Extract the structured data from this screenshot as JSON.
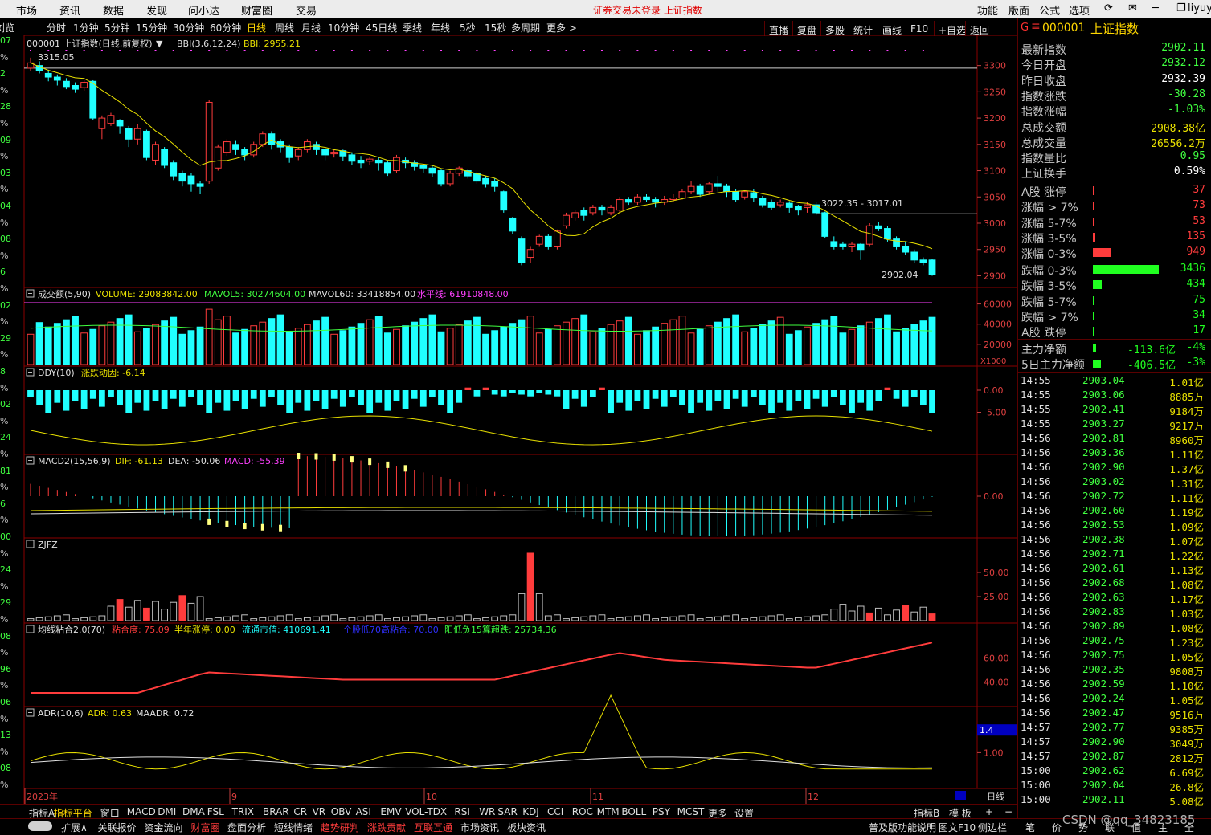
{
  "menubar": {
    "left": [
      "市场",
      "资讯",
      "数据",
      "发现",
      "问小达",
      "财富圈",
      "交易"
    ],
    "status": "证券交易未登录  上证指数",
    "right": [
      "功能",
      "版面",
      "公式",
      "选项"
    ],
    "user": "liyuyi"
  },
  "toolbar": {
    "left_clip": "浏览",
    "periods": [
      "分时",
      "1分钟",
      "5分钟",
      "15分钟",
      "30分钟",
      "60分钟",
      "日线",
      "周线",
      "月线",
      "10分钟",
      "45日线",
      "季线",
      "年线",
      "5秒",
      "15秒",
      "多周期",
      "更多 >"
    ],
    "active": "日线",
    "right": [
      "直播",
      "复盘",
      "多股",
      "统计",
      "画线",
      "F10",
      "+自选",
      "返回"
    ]
  },
  "left_strip": [
    "07",
    "%",
    "2",
    "%",
    "28",
    "%",
    "09",
    "%",
    "03",
    "%",
    "04",
    "%",
    "08",
    "%",
    "6",
    "%",
    "02",
    "%",
    "29",
    "%",
    "8",
    "%",
    "02",
    "%",
    "24",
    "%",
    "81",
    "%",
    "6",
    "%",
    "00",
    "%",
    "24",
    "%",
    "29",
    "%",
    "08",
    "%",
    "96",
    "%",
    "06",
    "%",
    "13",
    "%",
    "08",
    "%"
  ],
  "main_panel": {
    "title": "000001 上证指数(日线,前复权)",
    "bbi_label": "BBI(3,6,12,24)",
    "bbi_value": "BBI: 2955.21",
    "high_label": "3315.05",
    "mid_label": "3022.35 - 3017.01",
    "low_label": "2902.04",
    "y_ticks": [
      "3300",
      "3250",
      "3200",
      "3150",
      "3100",
      "3050",
      "3000",
      "2950",
      "2900"
    ]
  },
  "volume_panel": {
    "title": "成交额(5,90)",
    "volume": "VOLUME: 29083842.00",
    "mavol5": "MAVOL5: 30274604.00",
    "mavol60": "MAVOL60: 33418854.00",
    "level": "水平线: 61910848.00",
    "y_ticks": [
      "60000",
      "40000",
      "20000"
    ],
    "unit": "X1000"
  },
  "ddy_panel": {
    "title": "DDY(10)",
    "value": "涨跌动因: -6.14",
    "y_ticks": [
      "0.00",
      "-5.00"
    ]
  },
  "macd_panel": {
    "title": "MACD2(15,56,9)",
    "dif": "DIF: -61.13",
    "dea": "DEA: -50.06",
    "macd": "MACD: -55.39",
    "y_ticks": [
      "0.00"
    ]
  },
  "zjfz_panel": {
    "title": "ZJFZ",
    "y_ticks": [
      "50.00",
      "25.00"
    ]
  },
  "jxnh_panel": {
    "title": "均线粘合2.0(70)",
    "v1": "粘合度: 75.09",
    "v2": "半年涨停: 0.00",
    "v3": "流通市值: 410691.41",
    "v4": "个股低70高粘合: 70.00",
    "v5": "阳低负15算超跌: 25734.36",
    "y_ticks": [
      "60.00",
      "40.00"
    ]
  },
  "adr_panel": {
    "title": "ADR(10,6)",
    "adr": "ADR: 0.63",
    "maadr": "MAADR: 0.72",
    "y_ticks": [
      "1.00"
    ],
    "marker": "1.4"
  },
  "x_axis": {
    "labels": [
      "2023年",
      "9",
      "10",
      "11",
      "12"
    ],
    "right": "日线"
  },
  "indicator_tabs": [
    "指标A",
    "指标平台",
    "窗口",
    "MACD",
    "DMI",
    "DMA",
    "FSL",
    "TRIX",
    "BRAR",
    "CR",
    "VR",
    "OBV",
    "ASI",
    "EMV",
    "VOL-TDX",
    "RSI",
    "WR",
    "SAR",
    "KDJ",
    "CCI",
    "ROC",
    "MTM",
    "BOLL",
    "PSY",
    "MCST",
    "更多",
    "设置"
  ],
  "indicator_right": [
    "指标B",
    "模 板"
  ],
  "bottom_tabs": [
    "扩展∧",
    "关联报价",
    "资金流向",
    "财富圈",
    "盘面分析",
    "短线情绪",
    "趋势研判",
    "涨跌贡献",
    "互联互通",
    "市场资讯",
    "板块资讯"
  ],
  "bottom_right": [
    "普及版功能说明",
    "图文F10",
    "侧边栏"
  ],
  "bottom_far": [
    "笔",
    "价",
    "势",
    "联",
    "值",
    "主",
    "全"
  ],
  "watermark": "CSDN @qq_34823185",
  "quote": {
    "header_code": "000001",
    "header_name": "上证指数",
    "rows": [
      {
        "label": "最新指数",
        "value": "2902.11",
        "color": "#40ff40"
      },
      {
        "label": "今日开盘",
        "value": "2932.12",
        "color": "#40ff40"
      },
      {
        "label": "昨日收盘",
        "value": "2932.39",
        "color": "#ffffff"
      },
      {
        "label": "指数涨跌",
        "value": "-30.28",
        "color": "#40ff40"
      },
      {
        "label": "指数涨幅",
        "value": "-1.03%",
        "color": "#40ff40"
      },
      {
        "label": "总成交额",
        "value": "2908.38亿",
        "color": "#e8e000"
      },
      {
        "label": "总成交量",
        "value": "26556.2万",
        "color": "#e8e000"
      },
      {
        "label": "指数量比",
        "value": "0.95",
        "color": "#40ff40"
      },
      {
        "label": "上证换手",
        "value": "0.59%",
        "color": "#ffffff"
      }
    ],
    "up_rows": [
      {
        "label": "A股 涨停",
        "value": "37",
        "bar": 0.02
      },
      {
        "label": "涨幅 > 7%",
        "value": "73",
        "bar": 0.02
      },
      {
        "label": "涨幅 5-7%",
        "value": "53",
        "bar": 0.02
      },
      {
        "label": "涨幅 3-5%",
        "value": "135",
        "bar": 0.04
      },
      {
        "label": "涨幅 0-3%",
        "value": "949",
        "bar": 0.27
      }
    ],
    "down_rows": [
      {
        "label": "跌幅 0-3%",
        "value": "3436",
        "bar": 1.0
      },
      {
        "label": "跌幅 3-5%",
        "value": "434",
        "bar": 0.13
      },
      {
        "label": "跌幅 5-7%",
        "value": "75",
        "bar": 0.02
      },
      {
        "label": "跌幅 > 7%",
        "value": "34",
        "bar": 0.02
      },
      {
        "label": "A股 跌停",
        "value": "17",
        "bar": 0.02
      }
    ],
    "flow_rows": [
      {
        "label": "主力净额",
        "value": "-113.6亿",
        "pct": "-4%",
        "bar": 0.3
      },
      {
        "label": "5日主力净额",
        "value": "-406.5亿",
        "pct": "-3%",
        "bar": 0.7
      }
    ],
    "ticks": [
      {
        "t": "14:55",
        "p": "2903.04",
        "v": "1.01亿"
      },
      {
        "t": "14:55",
        "p": "2903.06",
        "v": "8885万"
      },
      {
        "t": "14:55",
        "p": "2902.41",
        "v": "9184万"
      },
      {
        "t": "14:55",
        "p": "2903.27",
        "v": "9217万"
      },
      {
        "t": "14:56",
        "p": "2902.81",
        "v": "8960万"
      },
      {
        "t": "14:56",
        "p": "2903.36",
        "v": "1.11亿"
      },
      {
        "t": "14:56",
        "p": "2902.90",
        "v": "1.37亿"
      },
      {
        "t": "14:56",
        "p": "2903.02",
        "v": "1.31亿"
      },
      {
        "t": "14:56",
        "p": "2902.72",
        "v": "1.11亿"
      },
      {
        "t": "14:56",
        "p": "2902.60",
        "v": "1.19亿"
      },
      {
        "t": "14:56",
        "p": "2902.53",
        "v": "1.09亿"
      },
      {
        "t": "14:56",
        "p": "2902.38",
        "v": "1.07亿"
      },
      {
        "t": "14:56",
        "p": "2902.71",
        "v": "1.22亿"
      },
      {
        "t": "14:56",
        "p": "2902.61",
        "v": "1.13亿"
      },
      {
        "t": "14:56",
        "p": "2902.68",
        "v": "1.08亿"
      },
      {
        "t": "14:56",
        "p": "2902.63",
        "v": "1.17亿"
      },
      {
        "t": "14:56",
        "p": "2902.83",
        "v": "1.03亿"
      },
      {
        "t": "14:56",
        "p": "2902.89",
        "v": "1.08亿"
      },
      {
        "t": "14:56",
        "p": "2902.75",
        "v": "1.23亿"
      },
      {
        "t": "14:56",
        "p": "2902.75",
        "v": "1.05亿"
      },
      {
        "t": "14:56",
        "p": "2902.35",
        "v": "9808万"
      },
      {
        "t": "14:56",
        "p": "2902.59",
        "v": "1.10亿"
      },
      {
        "t": "14:56",
        "p": "2902.24",
        "v": "1.05亿"
      },
      {
        "t": "14:56",
        "p": "2902.47",
        "v": "9516万"
      },
      {
        "t": "14:57",
        "p": "2902.77",
        "v": "9385万"
      },
      {
        "t": "14:57",
        "p": "2902.90",
        "v": "3049万"
      },
      {
        "t": "14:57",
        "p": "2902.87",
        "v": "2812万"
      },
      {
        "t": "15:00",
        "p": "2902.62",
        "v": "6.69亿"
      },
      {
        "t": "15:00",
        "p": "2902.04",
        "v": "26.8亿"
      },
      {
        "t": "15:00",
        "p": "2902.11",
        "v": "5.08亿"
      }
    ]
  },
  "chart_data": {
    "type": "candlestick",
    "title": "000001 上证指数(日线,前复权)",
    "x_month_marks": [
      "2023年",
      "9",
      "10",
      "11",
      "12"
    ],
    "ylim": [
      2890,
      3330
    ],
    "candles": [
      [
        3295,
        3305,
        3290,
        3315
      ],
      [
        3300,
        3290,
        3285,
        3308
      ],
      [
        3285,
        3278,
        3270,
        3292
      ],
      [
        3278,
        3272,
        3262,
        3283
      ],
      [
        3270,
        3260,
        3255,
        3276
      ],
      [
        3262,
        3255,
        3248,
        3268
      ],
      [
        3258,
        3268,
        3252,
        3272
      ],
      [
        3270,
        3200,
        3196,
        3272
      ],
      [
        3180,
        3200,
        3160,
        3205
      ],
      [
        3190,
        3205,
        3185,
        3210
      ],
      [
        3195,
        3185,
        3170,
        3198
      ],
      [
        3180,
        3160,
        3145,
        3185
      ],
      [
        3160,
        3180,
        3150,
        3188
      ],
      [
        3175,
        3125,
        3120,
        3178
      ],
      [
        3120,
        3150,
        3110,
        3155
      ],
      [
        3140,
        3110,
        3105,
        3145
      ],
      [
        3115,
        3090,
        3082,
        3120
      ],
      [
        3095,
        3080,
        3070,
        3100
      ],
      [
        3090,
        3075,
        3060,
        3095
      ],
      [
        3075,
        3070,
        3055,
        3080
      ],
      [
        3080,
        3230,
        3075,
        3235
      ],
      [
        3105,
        3145,
        3100,
        3150
      ],
      [
        3135,
        3155,
        3128,
        3160
      ],
      [
        3150,
        3140,
        3130,
        3158
      ],
      [
        3140,
        3130,
        3120,
        3145
      ],
      [
        3130,
        3150,
        3125,
        3155
      ],
      [
        3150,
        3170,
        3145,
        3175
      ],
      [
        3170,
        3150,
        3140,
        3175
      ],
      [
        3155,
        3145,
        3135,
        3160
      ],
      [
        3145,
        3125,
        3115,
        3150
      ],
      [
        3128,
        3140,
        3120,
        3145
      ],
      [
        3140,
        3155,
        3135,
        3160
      ],
      [
        3150,
        3140,
        3130,
        3155
      ],
      [
        3140,
        3130,
        3120,
        3145
      ],
      [
        3132,
        3135,
        3125,
        3140
      ],
      [
        3138,
        3128,
        3118,
        3140
      ],
      [
        3130,
        3118,
        3110,
        3135
      ],
      [
        3120,
        3115,
        3105,
        3128
      ],
      [
        3118,
        3122,
        3110,
        3126
      ],
      [
        3120,
        3115,
        3100,
        3125
      ],
      [
        3115,
        3095,
        3090,
        3120
      ],
      [
        3100,
        3125,
        3095,
        3130
      ],
      [
        3120,
        3115,
        3105,
        3125
      ],
      [
        3115,
        3108,
        3100,
        3120
      ],
      [
        3110,
        3105,
        3095,
        3112
      ],
      [
        3105,
        3095,
        3088,
        3110
      ],
      [
        3100,
        3075,
        3070,
        3102
      ],
      [
        3075,
        3095,
        3070,
        3100
      ],
      [
        3095,
        3105,
        3090,
        3108
      ],
      [
        3100,
        3090,
        3085,
        3102
      ],
      [
        3095,
        3080,
        3075,
        3098
      ],
      [
        3085,
        3075,
        3068,
        3090
      ],
      [
        3080,
        3070,
        3060,
        3085
      ],
      [
        3060,
        3025,
        3020,
        3062
      ],
      [
        3010,
        2985,
        2980,
        3012
      ],
      [
        2970,
        2925,
        2920,
        2975
      ],
      [
        2935,
        2950,
        2925,
        2955
      ],
      [
        2960,
        2975,
        2955,
        2978
      ],
      [
        2975,
        2955,
        2950,
        2980
      ],
      [
        2955,
        2985,
        2950,
        2988
      ],
      [
        2995,
        3015,
        2990,
        3020
      ],
      [
        3010,
        3020,
        3005,
        3025
      ],
      [
        3025,
        3015,
        3005,
        3030
      ],
      [
        3020,
        3030,
        3015,
        3035
      ],
      [
        3030,
        3025,
        3015,
        3035
      ],
      [
        3020,
        3030,
        3015,
        3035
      ],
      [
        3025,
        3045,
        3020,
        3050
      ],
      [
        3045,
        3040,
        3035,
        3050
      ],
      [
        3040,
        3050,
        3035,
        3055
      ],
      [
        3050,
        3045,
        3040,
        3055
      ],
      [
        3045,
        3040,
        3030,
        3050
      ],
      [
        3040,
        3045,
        3035,
        3052
      ],
      [
        3045,
        3048,
        3040,
        3055
      ],
      [
        3048,
        3060,
        3045,
        3065
      ],
      [
        3060,
        3070,
        3055,
        3080
      ],
      [
        3070,
        3055,
        3050,
        3075
      ],
      [
        3060,
        3075,
        3055,
        3078
      ],
      [
        3075,
        3070,
        3060,
        3090
      ],
      [
        3070,
        3060,
        3050,
        3075
      ],
      [
        3060,
        3045,
        3040,
        3065
      ],
      [
        3050,
        3060,
        3045,
        3062
      ],
      [
        3058,
        3048,
        3040,
        3065
      ],
      [
        3048,
        3035,
        3030,
        3052
      ],
      [
        3040,
        3030,
        3025,
        3045
      ],
      [
        3035,
        3040,
        3030,
        3045
      ],
      [
        3038,
        3030,
        3020,
        3042
      ],
      [
        3032,
        3025,
        3015,
        3035
      ],
      [
        3030,
        3035,
        3020,
        3040
      ],
      [
        3035,
        3020,
        3015,
        3040
      ],
      [
        3020,
        2975,
        2972,
        3022
      ],
      [
        2965,
        2955,
        2950,
        2975
      ],
      [
        2960,
        2955,
        2950,
        2965
      ],
      [
        2955,
        2960,
        2945,
        2965
      ],
      [
        2960,
        2950,
        2930,
        2962
      ],
      [
        2960,
        2995,
        2955,
        3000
      ],
      [
        2995,
        2990,
        2985,
        3002
      ],
      [
        2990,
        2970,
        2965,
        2995
      ],
      [
        2970,
        2955,
        2950,
        2975
      ],
      [
        2955,
        2945,
        2940,
        2965
      ],
      [
        2945,
        2930,
        2925,
        2950
      ],
      [
        2930,
        2925,
        2920,
        2935
      ],
      [
        2930,
        2902,
        2900,
        2932
      ]
    ]
  }
}
